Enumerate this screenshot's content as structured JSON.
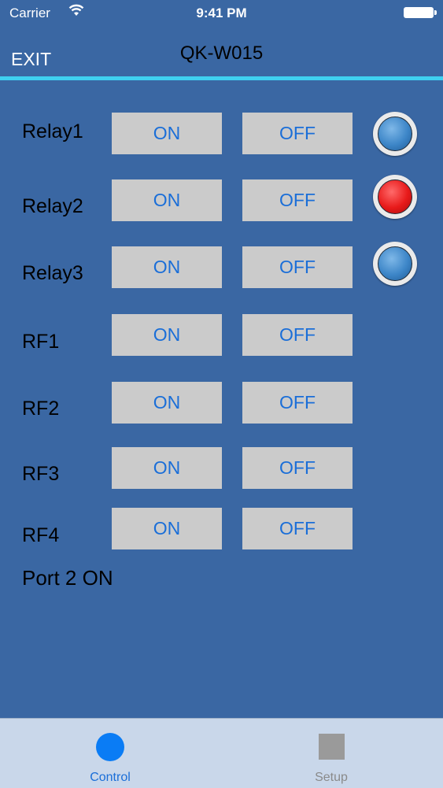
{
  "status_bar": {
    "carrier": "Carrier",
    "time": "9:41 PM"
  },
  "nav": {
    "exit_label": "EXIT",
    "title": "QK-W015"
  },
  "rows": [
    {
      "label": "Relay1",
      "on_label": "ON",
      "off_label": "OFF",
      "indicator": "blue"
    },
    {
      "label": "Relay2",
      "on_label": "ON",
      "off_label": "OFF",
      "indicator": "red"
    },
    {
      "label": "Relay3",
      "on_label": "ON",
      "off_label": "OFF",
      "indicator": "blue"
    },
    {
      "label": "RF1",
      "on_label": "ON",
      "off_label": "OFF"
    },
    {
      "label": "RF2",
      "on_label": "ON",
      "off_label": "OFF"
    },
    {
      "label": "RF3",
      "on_label": "ON",
      "off_label": "OFF"
    },
    {
      "label": "RF4",
      "on_label": "ON",
      "off_label": "OFF"
    }
  ],
  "status_message": "Port 2 ON",
  "tabs": [
    {
      "label": "Control",
      "icon": "circle-icon",
      "selected": true
    },
    {
      "label": "Setup",
      "icon": "square-icon",
      "selected": false
    }
  ],
  "colors": {
    "background": "#3a67a3",
    "accent_line": "#3fd0f0",
    "button_text": "#1a6ed8",
    "indicator_blue": "#3d86c8",
    "indicator_red": "#e81a1a"
  }
}
